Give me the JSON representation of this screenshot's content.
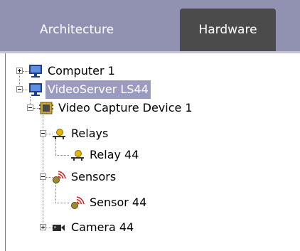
{
  "tabs": [
    {
      "label": "Architecture",
      "active": false
    },
    {
      "label": "Hardware",
      "active": true
    }
  ],
  "tree": {
    "computer": {
      "label": "Computer 1",
      "icon": "monitor-icon",
      "expanded": false
    },
    "server": {
      "label": "VideoServer LS44",
      "icon": "monitor-icon",
      "expanded": true,
      "selected": true
    },
    "capture": {
      "label": "Video Capture Device 1",
      "icon": "capture-card-icon",
      "expanded": true
    },
    "relays": {
      "label": "Relays",
      "icon": "relay-icon",
      "expanded": true
    },
    "relay": {
      "label": "Relay 44",
      "icon": "relay-icon"
    },
    "sensors": {
      "label": "Sensors",
      "icon": "sensor-icon",
      "expanded": true
    },
    "sensor": {
      "label": "Sensor 44",
      "icon": "sensor-icon"
    },
    "camera": {
      "label": "Camera 44",
      "icon": "camera-icon",
      "expanded": false
    }
  },
  "colors": {
    "tabbar": "#9191b2",
    "active_tab": "#4b4b4b",
    "selection": "#9b9bc0",
    "sensor_red": "#d01c1c"
  }
}
